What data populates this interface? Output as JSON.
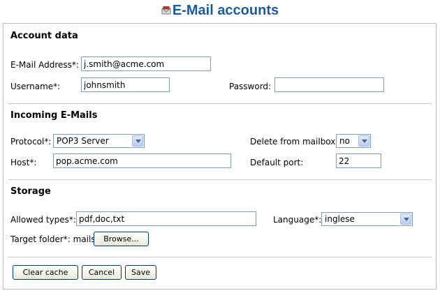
{
  "page": {
    "title": "E-Mail accounts",
    "title_icon": "mail-icon"
  },
  "account": {
    "section_title": "Account data",
    "email_label": "E-Mail Address*:",
    "email_value": "j.smith@acme.com",
    "username_label": "Username*:",
    "username_value": "johnsmith",
    "password_label": "Password:",
    "password_value": ""
  },
  "incoming": {
    "section_title": "Incoming E-Mails",
    "protocol_label": "Protocol*:",
    "protocol_value": "POP3 Server",
    "delete_label": "Delete from mailbox:",
    "delete_value": "no",
    "host_label": "Host*:",
    "host_value": "pop.acme.com",
    "port_label": "Default port:",
    "port_value": "22"
  },
  "storage": {
    "section_title": "Storage",
    "types_label": "Allowed types*:",
    "types_value": "pdf,doc,txt",
    "language_label": "Language*:",
    "language_value": "inglese",
    "folder_label": "Target folder*: mails",
    "browse_label": "Browse..."
  },
  "actions": {
    "clear_cache_label": "Clear cache",
    "cancel_label": "Cancel",
    "save_label": "Save"
  },
  "colors": {
    "title": "#1f5b99",
    "input_border": "#7f9db9",
    "button_border": "#003c74"
  }
}
